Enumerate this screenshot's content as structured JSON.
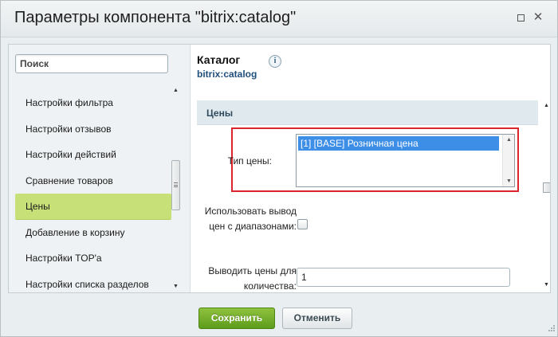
{
  "dialog": {
    "title": "Параметры компонента \"bitrix:catalog\"",
    "minimize_icon": "minimize-icon",
    "close_icon": "close-icon",
    "close_glyph": "✕"
  },
  "sidebar": {
    "search_placeholder": "Поиск",
    "items": [
      {
        "label": "Настройки фильтра"
      },
      {
        "label": "Настройки отзывов"
      },
      {
        "label": "Настройки действий"
      },
      {
        "label": "Сравнение товаров"
      },
      {
        "label": "Цены"
      },
      {
        "label": "Добавление в корзину"
      },
      {
        "label": "Настройки TOP'a"
      },
      {
        "label": "Настройки списка разделов"
      }
    ],
    "active_item": "Цены"
  },
  "panel": {
    "title": "Каталог",
    "subtitle": "bitrix:catalog",
    "info_icon": "info-icon",
    "info_glyph": "i",
    "section_title": "Цены",
    "price_type": {
      "label": "Тип цены:",
      "options": [
        "[1] [BASE] Розничная цена"
      ],
      "selected": "[1] [BASE] Розничная цена"
    },
    "use_ranges": {
      "label": "Использовать вывод цен с диапазонами:",
      "checked": false
    },
    "quantity": {
      "label": "Выводить цены для количества:",
      "value": "1"
    }
  },
  "footer": {
    "save_label": "Сохранить",
    "cancel_label": "Отменить"
  },
  "colors": {
    "active_item": "#c7e078",
    "selected_option": "#3d8ee6",
    "highlight_border": "#d9252b",
    "save_button": "#6aa82a"
  }
}
